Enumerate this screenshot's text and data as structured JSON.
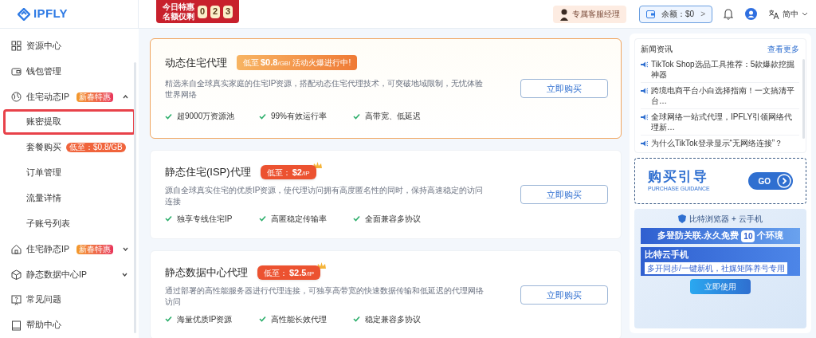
{
  "header": {
    "logo": "IPFLY",
    "promo": {
      "line1": "今日特惠",
      "line2": "名额仅剩",
      "digits": [
        "0",
        "2",
        "3"
      ]
    },
    "manager": "专属客服经理",
    "balance": "余额：$0",
    "balance_arrow": ">",
    "language": "简中"
  },
  "sidebar": {
    "items": [
      {
        "kind": "grid",
        "label": "资源中心"
      },
      {
        "kind": "wallet",
        "label": "钱包管理"
      },
      {
        "kind": "globe",
        "label": "住宅动态IP",
        "badge": "新春特惠",
        "expanded": true,
        "children": [
          {
            "label": "账密提取",
            "highlighted": true
          },
          {
            "label": "套餐购买",
            "badge": "低至：$0.8/GB",
            "highlighted": false
          },
          {
            "label": "订单管理",
            "highlighted": false
          },
          {
            "label": "流量详情",
            "highlighted": false
          },
          {
            "label": "子账号列表",
            "highlighted": false
          }
        ]
      },
      {
        "kind": "home",
        "label": "住宅静态IP",
        "badge": "新春特惠",
        "expanded": false
      },
      {
        "kind": "cube",
        "label": "静态数据中心IP",
        "expanded": false
      },
      {
        "kind": "help",
        "label": "常见问题"
      },
      {
        "kind": "book",
        "label": "帮助中心"
      }
    ]
  },
  "products": [
    {
      "title": "动态住宅代理",
      "featured": true,
      "price": {
        "prefix": "低至",
        "amount": "$0.8",
        "unit": "/GB!",
        "suffix": "活动火爆进行中!"
      },
      "description": "精选来自全球真实家庭的住宅IP资源，搭配动态住宅代理技术，可突破地域限制，无忧体验世界网络",
      "features": [
        "超9000万资源池",
        "99%有效运行率",
        "高带宽、低延迟"
      ],
      "button": "立即购买"
    },
    {
      "title": "静态住宅(ISP)代理",
      "featured": false,
      "price": {
        "prefix": "低至：",
        "amount": "$2",
        "unit": "/IP"
      },
      "description": "源自全球真实住宅的优质IP资源，使代理访问拥有高度匿名性的同时，保持高速稳定的访问连接",
      "features": [
        "独享专线住宅IP",
        "高匿稳定传输率",
        "全面兼容多协议"
      ],
      "button": "立即购买"
    },
    {
      "title": "静态数据中心代理",
      "featured": false,
      "price": {
        "prefix": "低至：",
        "amount": "$2.5",
        "unit": "/IP"
      },
      "description": "通过部署的高性能服务器进行代理连接，可独享高带宽的快速数据传输和低延迟的代理网络访问",
      "features": [
        "海量优质IP资源",
        "高性能长效代理",
        "稳定兼容多协议"
      ],
      "button": "立即购买"
    }
  ],
  "news": {
    "title": "新闻资讯",
    "more": "查看更多",
    "items": [
      "TikTok Shop选品工具推荐：5款爆款挖掘神器",
      "跨境电商平台小白选择指南！一文搞清平台…",
      "全球网络一站式代理，IPFLY引领网络代理新…",
      "为什么TikTok登录显示“无网络连接”？"
    ]
  },
  "guide": {
    "title": "购买引导",
    "subtitle": "PURCHASE GUIDANCE",
    "button": "GO"
  },
  "ad": {
    "brand": "比特浏览器 + 云手机",
    "headline": "多登防关联.永久免费",
    "count": "10",
    "headline_end": "个环境",
    "product": "比特云手机",
    "tagline": "多开同步/一键新机，社媒矩阵养号专用",
    "button": "立即使用"
  }
}
